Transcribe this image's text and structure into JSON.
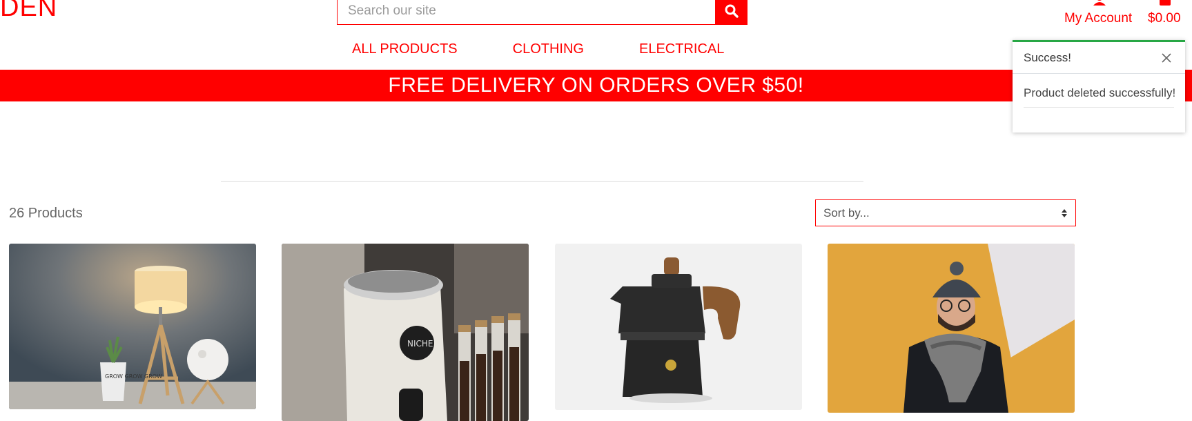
{
  "header": {
    "logo_text": "DEN",
    "search": {
      "placeholder": "Search our site"
    },
    "account_label": "My Account",
    "cart_total": "$0.00"
  },
  "nav": {
    "items": [
      "ALL PRODUCTS",
      "CLOTHING",
      "ELECTRICAL"
    ]
  },
  "banner": {
    "text": "FREE DELIVERY ON ORDERS OVER $50!"
  },
  "toast": {
    "title": "Success!",
    "message": "Product deleted successfully!"
  },
  "catalog": {
    "count_label": "26 Products",
    "sort": {
      "selected": "Sort by..."
    },
    "products": [
      {
        "image": "lamp-with-succulent-and-moon-light",
        "mug_text": "GROW GROW GROW"
      },
      {
        "image": "niche-coffee-grinder",
        "brand_text": "NICHE"
      },
      {
        "image": "stovetop-espresso-maker"
      },
      {
        "image": "man-in-beanie-and-scarf"
      }
    ]
  },
  "colors": {
    "brand": "#ff0000",
    "success": "#28a745",
    "banner_text": "#ffffff"
  },
  "icons": [
    "search-icon",
    "user-icon",
    "shopping-bag-icon",
    "close-icon",
    "sort-arrows-icon"
  ]
}
